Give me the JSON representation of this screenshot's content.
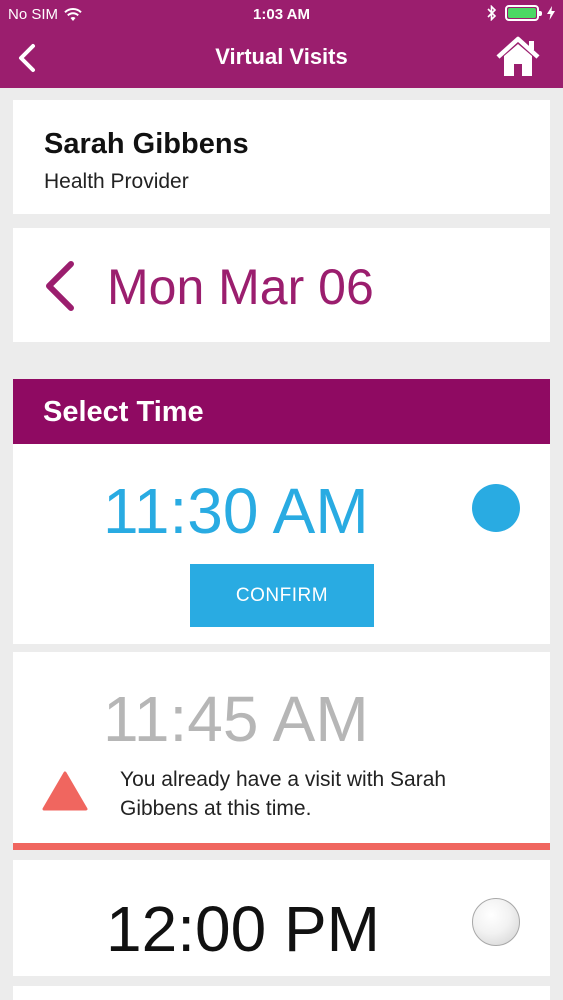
{
  "status_bar": {
    "carrier": "No SIM",
    "time": "1:03 AM"
  },
  "nav": {
    "title": "Virtual Visits"
  },
  "provider": {
    "name": "Sarah Gibbens",
    "role": "Health Provider"
  },
  "date": {
    "label": "Mon Mar 06"
  },
  "section": {
    "title": "Select Time"
  },
  "slots": [
    {
      "time": "11:30 AM",
      "selected": true,
      "confirm_label": "CONFIRM"
    },
    {
      "time": "11:45 AM",
      "conflict": true,
      "message": "You already have a visit with Sarah Gibbens at this time."
    },
    {
      "time": "12:00 PM",
      "selected": false
    }
  ],
  "colors": {
    "brand": "#9b1e6e",
    "section_header": "#8f0a62",
    "accent": "#29abe2",
    "warning": "#f0665f",
    "disabled_text": "#b6b6b6"
  }
}
